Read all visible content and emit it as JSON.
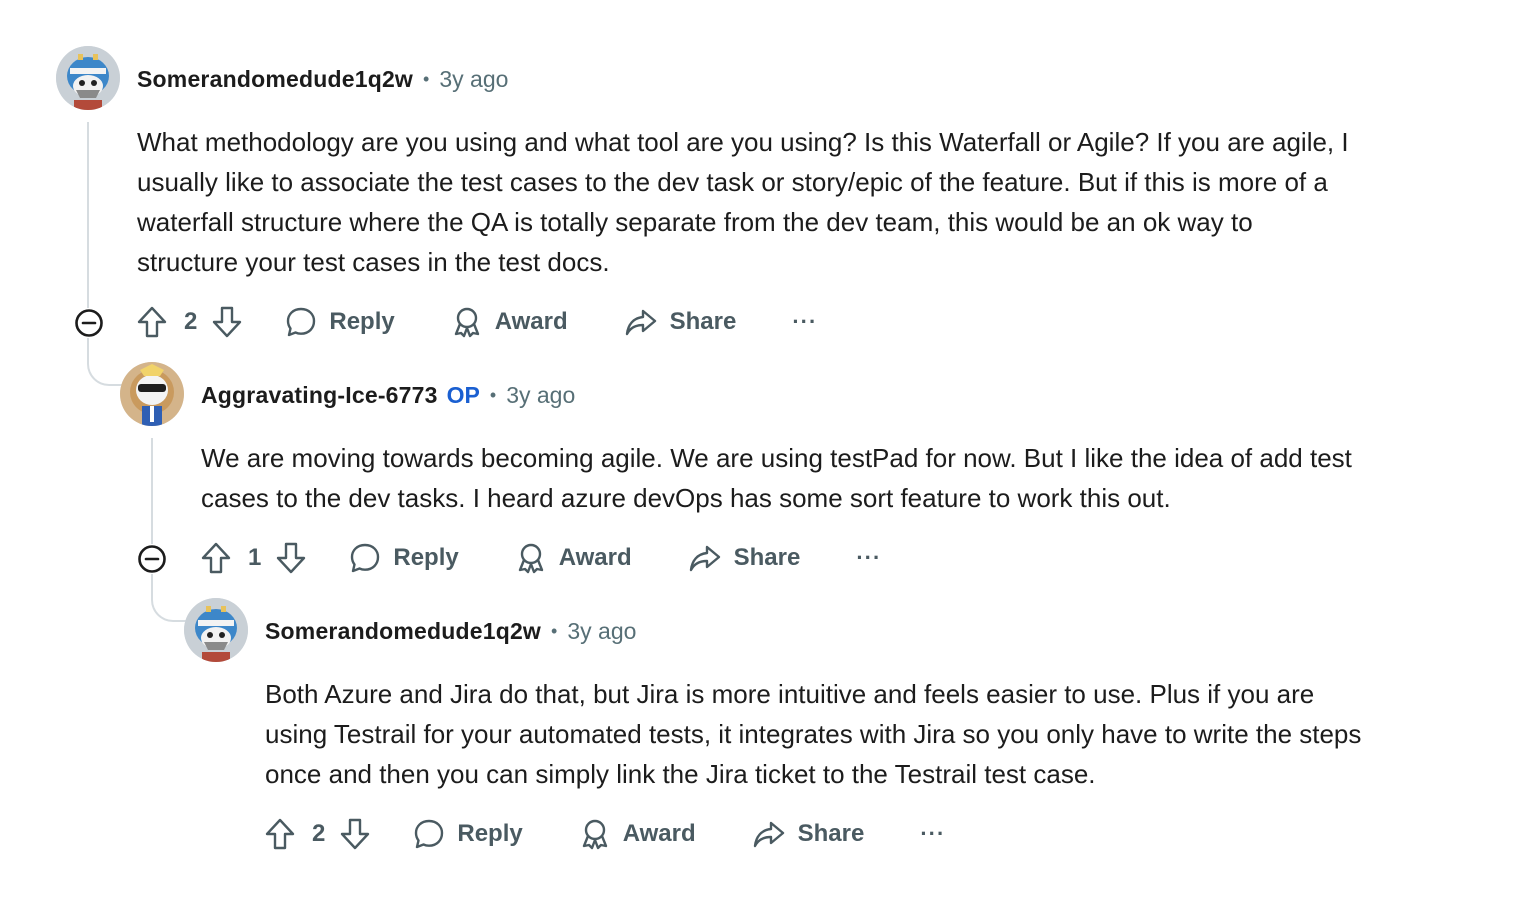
{
  "comments": [
    {
      "author": "Somerandomedude1q2w",
      "op_badge": "",
      "time": "3y ago",
      "separator": "•",
      "body": "What methodology are you using and what tool are you using? Is this Waterfall or Agile? If you are agile, I\nusually like to associate the test cases to the dev task or story/epic of the feature. But if this is more of a\nwaterfall structure where the QA is totally separate from the dev team, this would be an ok way to\nstructure your test cases in the test docs.",
      "votes": "2",
      "reply_label": "Reply",
      "award_label": "Award",
      "share_label": "Share",
      "more_label": "···"
    },
    {
      "author": "Aggravating-Ice-6773",
      "op_badge": "OP",
      "time": "3y ago",
      "separator": "•",
      "body": "We are moving towards becoming agile. We are using testPad for now. But I like the idea of add test\ncases to the dev tasks. I heard azure devOps has some sort feature to work this out.",
      "votes": "1",
      "reply_label": "Reply",
      "award_label": "Award",
      "share_label": "Share",
      "more_label": "···"
    },
    {
      "author": "Somerandomedude1q2w",
      "op_badge": "",
      "time": "3y ago",
      "separator": "•",
      "body": "Both Azure and Jira do that, but Jira is more intuitive and feels easier to use. Plus if you are\nusing Testrail for your automated tests, it integrates with Jira so you only have to write the steps\nonce and then you can simply link the Jira ticket to the Testrail test case.",
      "votes": "2",
      "reply_label": "Reply",
      "award_label": "Award",
      "share_label": "Share",
      "more_label": "···"
    }
  ],
  "colors": {
    "op": "#1a5fd1",
    "meta": "#576f76",
    "action": "#4a5a61",
    "thread": "#d6dce0"
  },
  "icons": [
    "collapse-icon",
    "upvote-icon",
    "downvote-icon",
    "reply-icon",
    "award-icon",
    "share-icon",
    "more-icon"
  ]
}
